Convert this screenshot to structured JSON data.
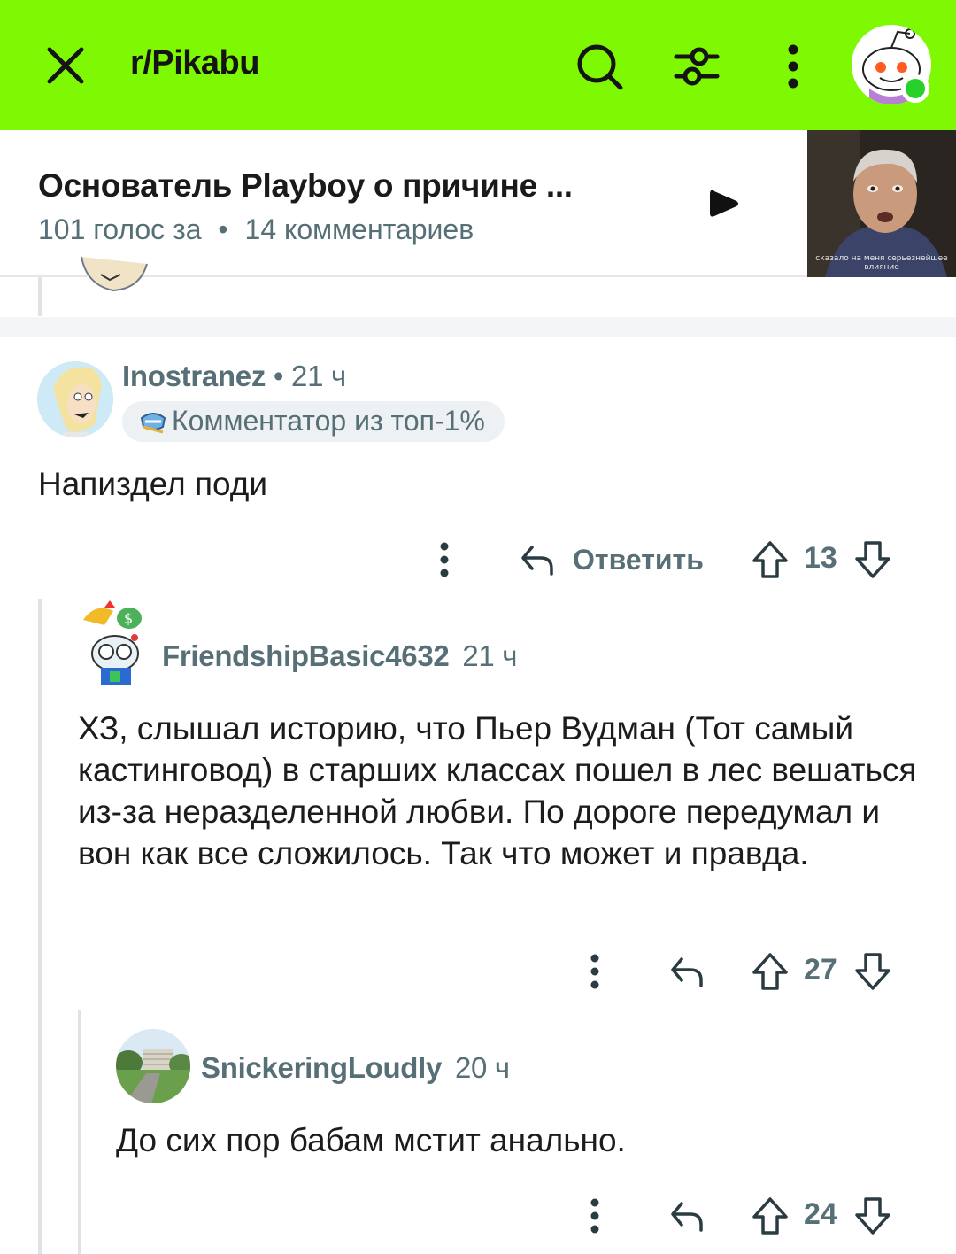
{
  "header": {
    "subreddit": "r/Pikabu",
    "close_icon": "close-icon",
    "search_icon": "search-icon",
    "filter_icon": "sliders-icon",
    "more_icon": "vertical-dots-icon",
    "bg_color": "#7ff804"
  },
  "post": {
    "title": "Основатель Playboy о причине ...",
    "votes": "101 голос за",
    "separator": "•",
    "comments": "14 комментариев",
    "thumbnail_caption": "сказало на меня серьезнейшее влияние"
  },
  "comments": [
    {
      "username": "Inostranez",
      "time": "• 21 ч",
      "badge": "Комментатор из топ-1%",
      "body": "Напиздел поди",
      "reply_label": "Ответить",
      "score": "13"
    },
    {
      "username": "FriendshipBasic4632",
      "time": "21 ч",
      "body": "ХЗ, слышал историю, что Пьер Вудман (Тот самый кастинговод) в старших классах пошел в лес вешаться из-за неразделенной любви. По дороге передумал и вон как все сложилось. Так что может и правда.",
      "score": "27"
    },
    {
      "username": "SnickeringLoudly",
      "time": "20 ч",
      "body": "До сих пор бабам мстит анально.",
      "score": "24"
    }
  ]
}
